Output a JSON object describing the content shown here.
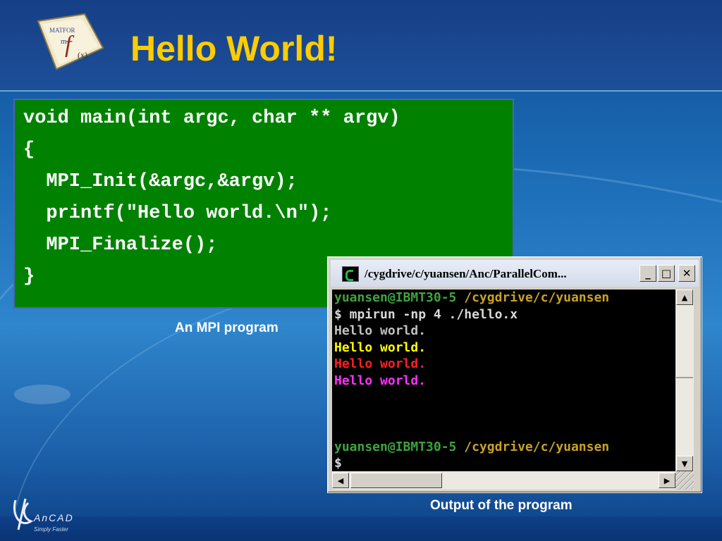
{
  "slide": {
    "title": "Hello World!"
  },
  "code": {
    "lines": [
      "void main(int argc, char ** argv)",
      "{",
      "  MPI_Init(&argc,&argv);",
      "  printf(\"Hello world.\\n\");",
      "  MPI_Finalize();",
      "}"
    ],
    "caption": "An MPI program"
  },
  "console": {
    "window_title": "/cygdrive/c/yuansen/Anc/ParallelCom...",
    "minimize_label": "_",
    "maximize_label": "□",
    "close_label": "✕",
    "lines": [
      {
        "text": "yuansen@IBMT30-5 ",
        "color": "#3fa33f",
        "text2": "/cygdrive/c/yuansen",
        "color2": "#c9a227"
      },
      {
        "text": "$ mpirun -np 4 ./hello.x",
        "color": "#d8d8d8"
      },
      {
        "text": "Hello world.",
        "color": "#c0c0c0"
      },
      {
        "text": "Hello world.",
        "color": "#ffff00"
      },
      {
        "text": "Hello world.",
        "color": "#ff2020"
      },
      {
        "text": "Hello world.",
        "color": "#ff30ff"
      },
      {
        "text": "",
        "color": "#c0c0c0"
      },
      {
        "text": "",
        "color": "#c0c0c0"
      },
      {
        "text": "",
        "color": "#c0c0c0"
      },
      {
        "text": "yuansen@IBMT30-5 ",
        "color": "#3fa33f",
        "text2": "/cygdrive/c/yuansen",
        "color2": "#c9a227"
      },
      {
        "text": "$",
        "color": "#d8d8d8"
      }
    ],
    "caption": "Output of the program"
  },
  "branding": {
    "footer_logo_text": "AnCAD",
    "footer_tagline": "Simply Faster"
  },
  "colors": {
    "title": "#ffcc00",
    "code_bg": "#008200"
  },
  "icons": [
    "logo-mfx-icon",
    "terminal-icon",
    "minimize-icon",
    "maximize-icon",
    "close-icon",
    "scroll-up-icon",
    "scroll-down-icon",
    "scroll-left-icon",
    "scroll-right-icon",
    "resize-grip-icon",
    "ancad-logo-icon"
  ]
}
